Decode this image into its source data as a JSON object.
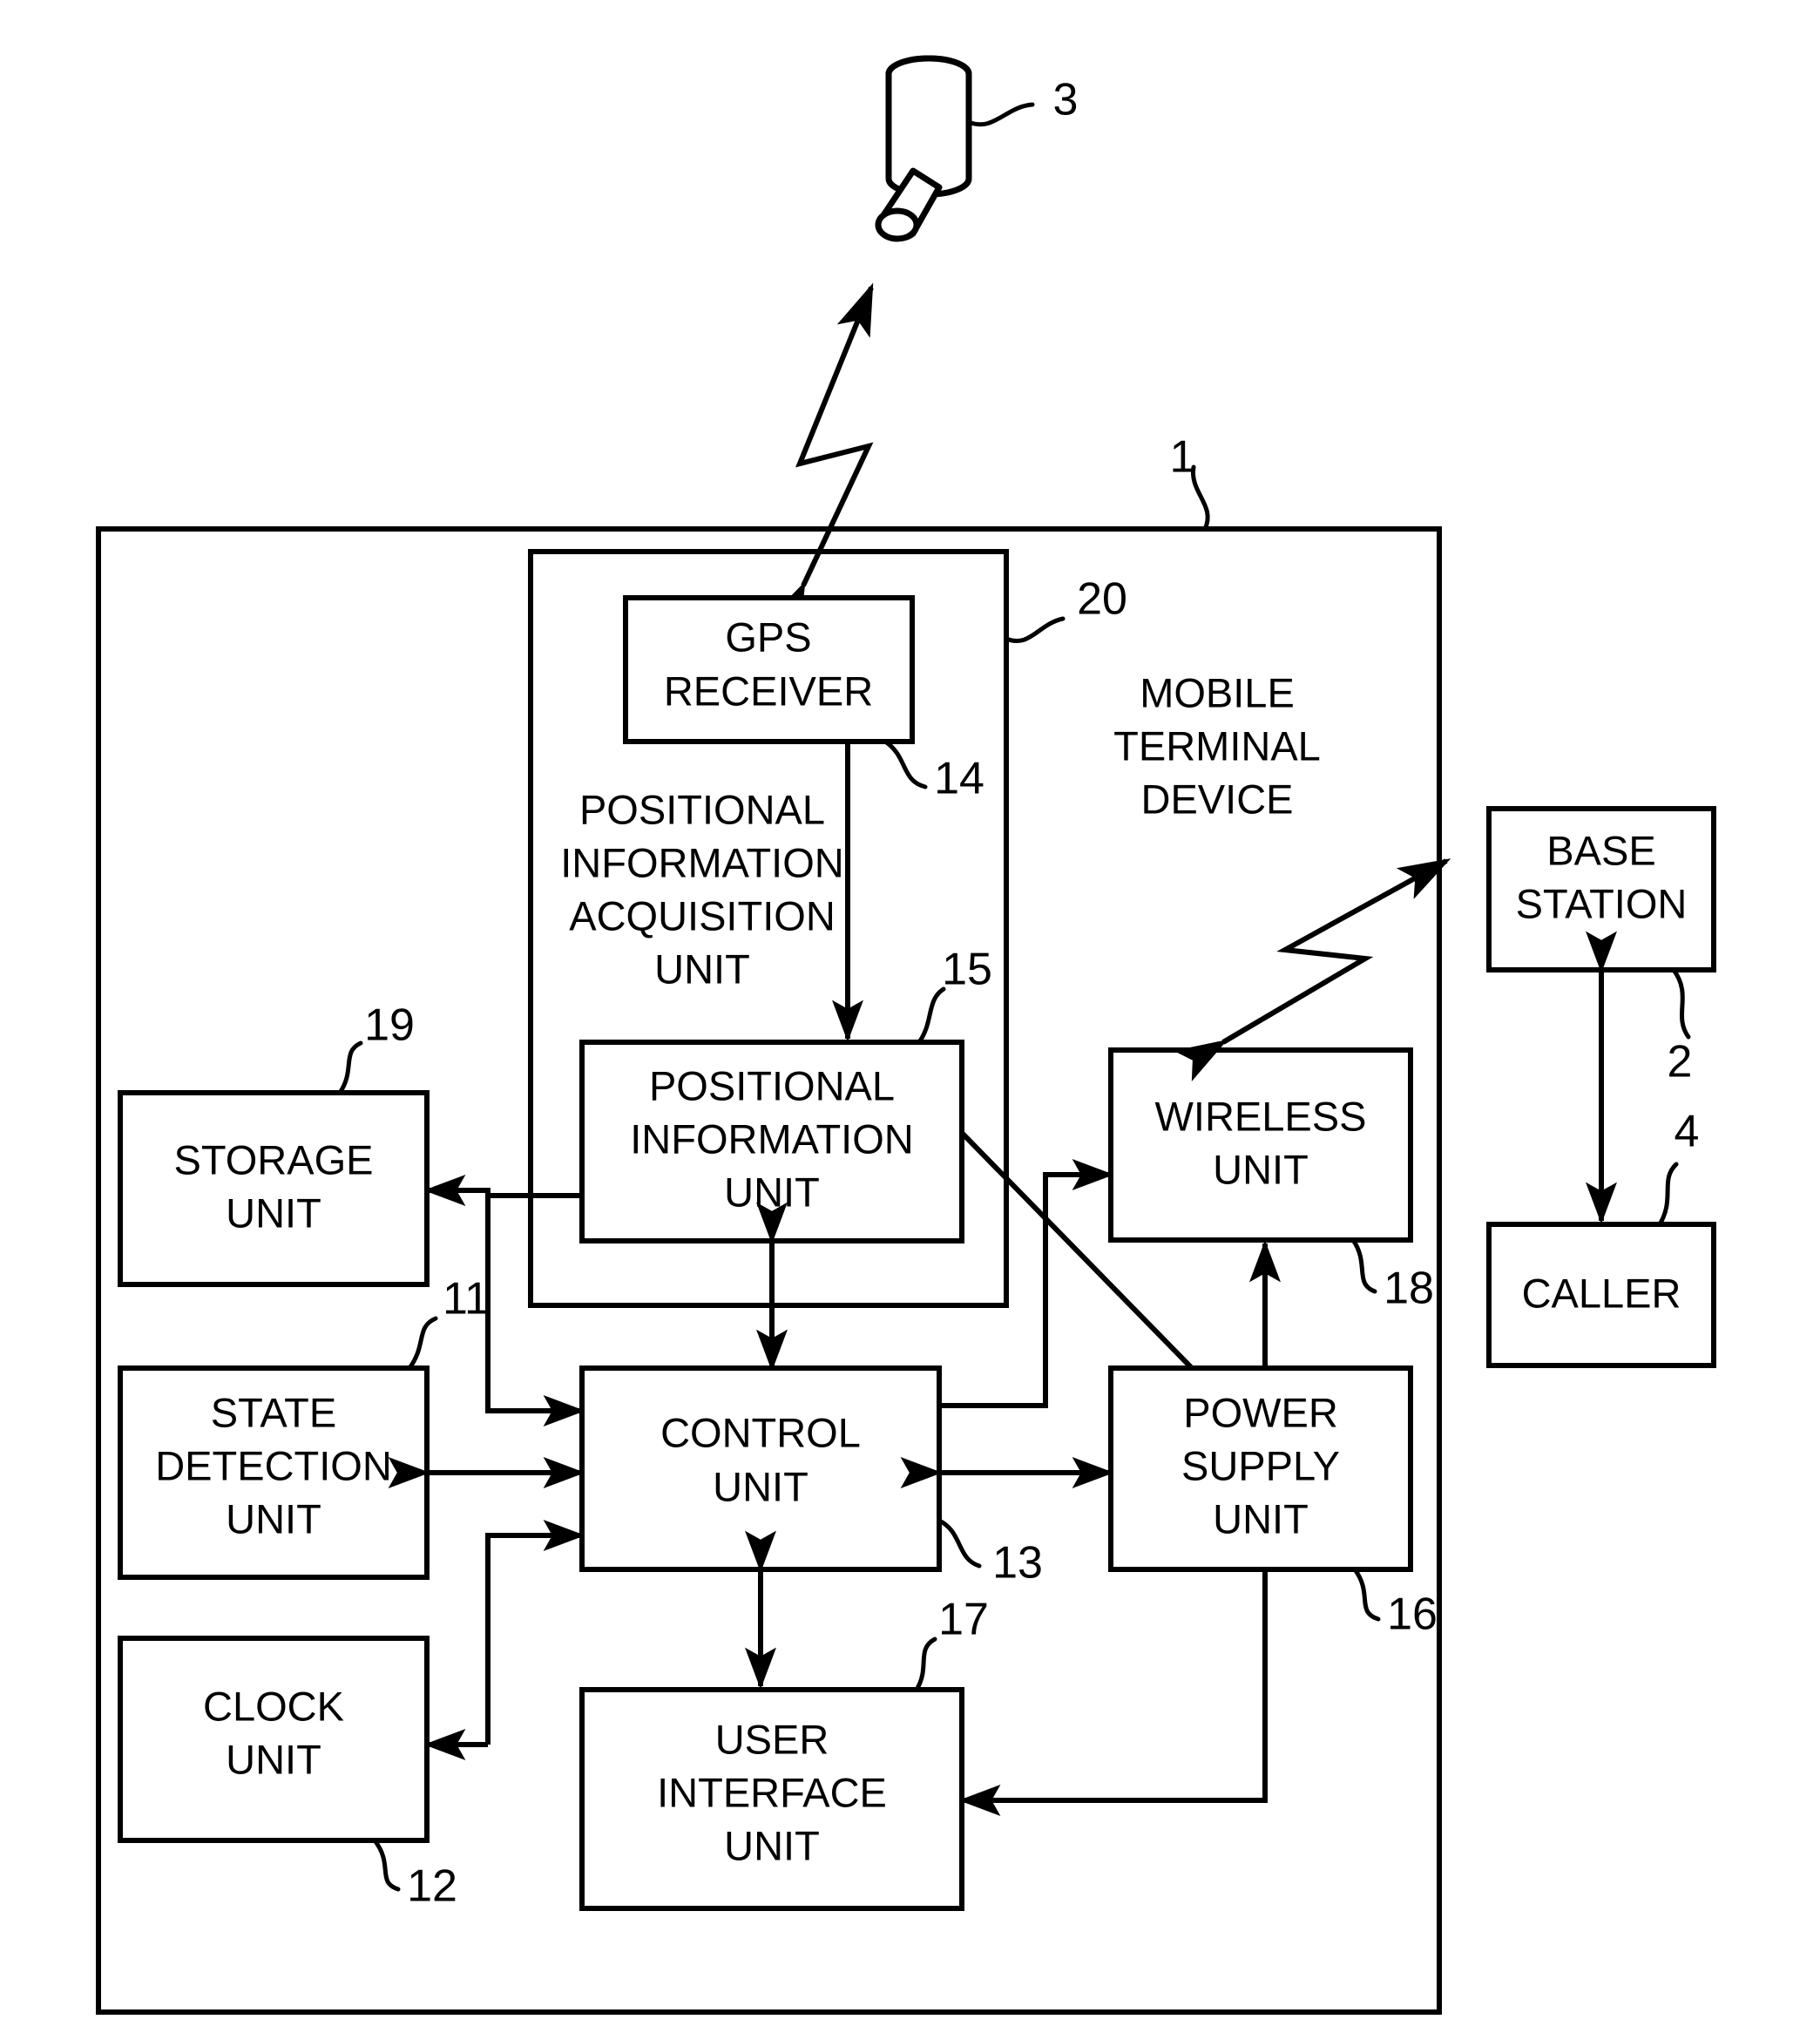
{
  "figure": {
    "kind": "patent-block-diagram",
    "title": "Mobile terminal device block diagram",
    "line_color": "#000000",
    "background_color": "#ffffff"
  },
  "external_nodes": {
    "satellite": {
      "label": "",
      "ref": "3",
      "icon": "gps-satellite-icon"
    },
    "base_station": {
      "label_line1": "BASE",
      "label_line2": "STATION",
      "ref": "2"
    },
    "caller": {
      "label": "CALLER",
      "ref": "4"
    }
  },
  "device": {
    "label_line1": "MOBILE",
    "label_line2": "TERMINAL",
    "label_line3": "DEVICE",
    "ref": "1"
  },
  "acquisition_group": {
    "label_line1": "POSITIONAL",
    "label_line2": "INFORMATION",
    "label_line3": "ACQUISITION",
    "label_line4": "UNIT",
    "ref": "20"
  },
  "blocks": [
    {
      "id": "gps-receiver",
      "lines": [
        "GPS",
        "RECEIVER"
      ],
      "ref": "14"
    },
    {
      "id": "positional-information-unit",
      "lines": [
        "POSITIONAL",
        "INFORMATION",
        "UNIT"
      ],
      "ref": "15"
    },
    {
      "id": "storage-unit",
      "lines": [
        "STORAGE",
        "UNIT"
      ],
      "ref": "19"
    },
    {
      "id": "state-detection-unit",
      "lines": [
        "STATE",
        "DETECTION",
        "UNIT"
      ],
      "ref": "11"
    },
    {
      "id": "clock-unit",
      "lines": [
        "CLOCK",
        "UNIT"
      ],
      "ref": "12"
    },
    {
      "id": "control-unit",
      "lines": [
        "CONTROL",
        "UNIT"
      ],
      "ref": "13"
    },
    {
      "id": "user-interface-unit",
      "lines": [
        "USER",
        "INTERFACE",
        "UNIT"
      ],
      "ref": "17"
    },
    {
      "id": "wireless-unit",
      "lines": [
        "WIRELESS",
        "UNIT"
      ],
      "ref": "18"
    },
    {
      "id": "power-supply-unit",
      "lines": [
        "POWER",
        "SUPPLY",
        "UNIT"
      ],
      "ref": "16"
    }
  ],
  "text": {
    "gps_l1": "GPS",
    "gps_l2": "RECEIVER",
    "gps_ref": "14",
    "piu_l1": "POSITIONAL",
    "piu_l2": "INFORMATION",
    "piu_l3": "UNIT",
    "piu_ref": "15",
    "acq_l1": "POSITIONAL",
    "acq_l2": "INFORMATION",
    "acq_l3": "ACQUISITION",
    "acq_l4": "UNIT",
    "acq_ref": "20",
    "mtd_l1": "MOBILE",
    "mtd_l2": "TERMINAL",
    "mtd_l3": "DEVICE",
    "mtd_ref": "1",
    "storage_l1": "STORAGE",
    "storage_l2": "UNIT",
    "storage_ref": "19",
    "state_l1": "STATE",
    "state_l2": "DETECTION",
    "state_l3": "UNIT",
    "state_ref": "11",
    "clock_l1": "CLOCK",
    "clock_l2": "UNIT",
    "clock_ref": "12",
    "control_l1": "CONTROL",
    "control_l2": "UNIT",
    "control_ref": "13",
    "ui_l1": "USER",
    "ui_l2": "INTERFACE",
    "ui_l3": "UNIT",
    "ui_ref": "17",
    "wireless_l1": "WIRELESS",
    "wireless_l2": "UNIT",
    "wireless_ref": "18",
    "power_l1": "POWER",
    "power_l2": "SUPPLY",
    "power_l3": "UNIT",
    "power_ref": "16",
    "base_l1": "BASE",
    "base_l2": "STATION",
    "base_ref": "2",
    "caller_l1": "CALLER",
    "caller_ref": "4",
    "satellite_ref": "3"
  }
}
